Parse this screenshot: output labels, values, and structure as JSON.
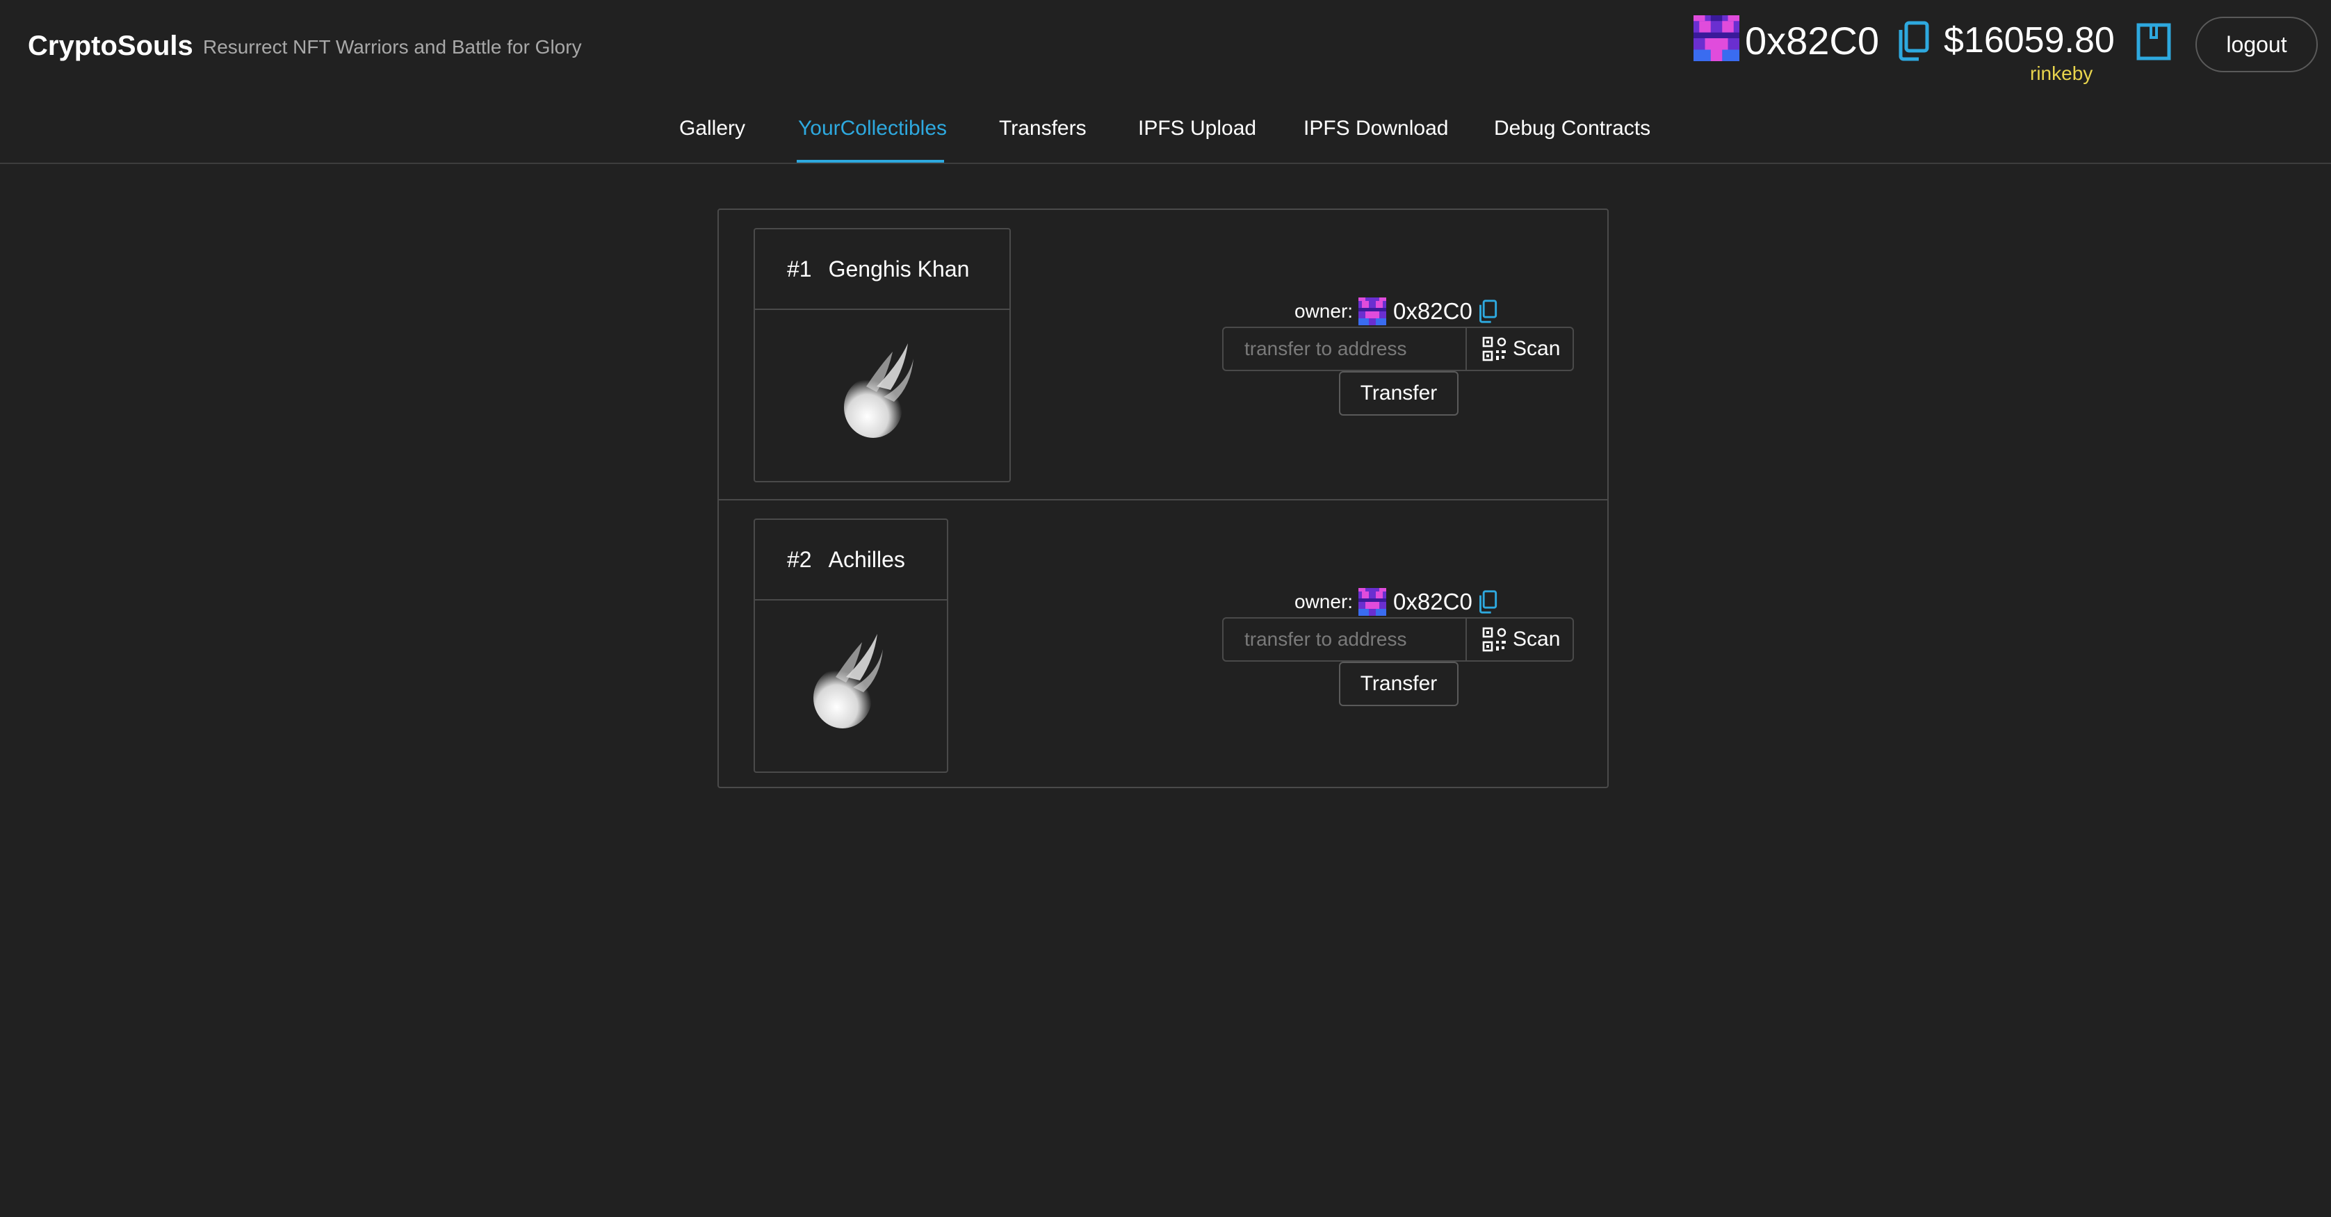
{
  "app": {
    "title": "CryptoSouls",
    "tagline": "Resurrect NFT Warriors and Battle for Glory"
  },
  "account": {
    "address": "0x82C0",
    "balance": "$16059.80",
    "network": "rinkeby",
    "logout_label": "logout"
  },
  "nav": {
    "tabs": [
      {
        "label": "Gallery"
      },
      {
        "label": "YourCollectibles"
      },
      {
        "label": "Transfers"
      },
      {
        "label": "IPFS Upload"
      },
      {
        "label": "IPFS Download"
      },
      {
        "label": "Debug Contracts"
      }
    ],
    "active": "YourCollectibles"
  },
  "collectibles": [
    {
      "id": "#1",
      "name": "Genghis Khan",
      "owner_label": "owner:",
      "owner_address": "0x82C0",
      "transfer_placeholder": "transfer to address",
      "scan_label": "Scan",
      "transfer_label": "Transfer"
    },
    {
      "id": "#2",
      "name": "Achilles",
      "owner_label": "owner:",
      "owner_address": "0x82C0",
      "transfer_placeholder": "transfer to address",
      "scan_label": "Scan",
      "transfer_label": "Transfer"
    }
  ],
  "colors": {
    "background": "#212121",
    "accent": "#2ea9df",
    "network": "#e8d44d",
    "blockie_purple": "#8a3ce0",
    "blockie_pink": "#e04cdc"
  },
  "icons": [
    "blockie-avatar",
    "copy-icon",
    "wallet-icon",
    "qr-code-icon",
    "soul-image"
  ]
}
